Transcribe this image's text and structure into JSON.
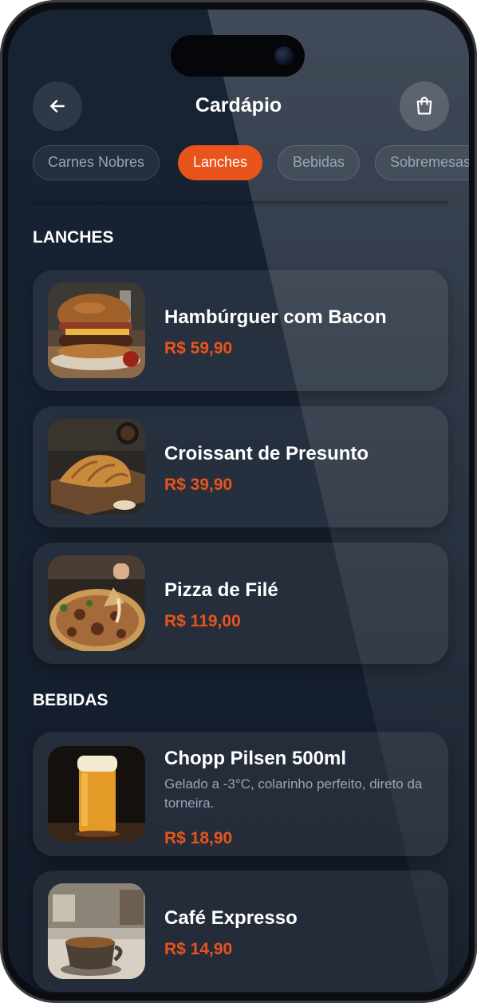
{
  "header": {
    "title": "Cardápio",
    "back_icon": "arrow-left-icon",
    "cart_icon": "shopping-bag-icon"
  },
  "categories": [
    {
      "label": "Carnes Nobres",
      "active": false
    },
    {
      "label": "Lanches",
      "active": true
    },
    {
      "label": "Bebidas",
      "active": false
    },
    {
      "label": "Sobremesas",
      "active": false
    }
  ],
  "sections": [
    {
      "title": "LANCHES",
      "items": [
        {
          "name": "Hambúrguer com Bacon",
          "price": "R$ 59,90"
        },
        {
          "name": "Croissant de Presunto",
          "price": "R$ 39,90"
        },
        {
          "name": "Pizza de Filé",
          "price": "R$ 119,00"
        }
      ]
    },
    {
      "title": "BEBIDAS",
      "items": [
        {
          "name": "Chopp Pilsen 500ml",
          "description": "Gelado a -3°C, colarinho perfeito, direto da torneira.",
          "price": "R$ 18,90"
        },
        {
          "name": "Café Expresso",
          "price": "R$ 14,90"
        }
      ]
    }
  ],
  "colors": {
    "accent": "#e8541c",
    "background": "#172233",
    "card": "#253043",
    "muted_text": "#9aa4b4"
  }
}
